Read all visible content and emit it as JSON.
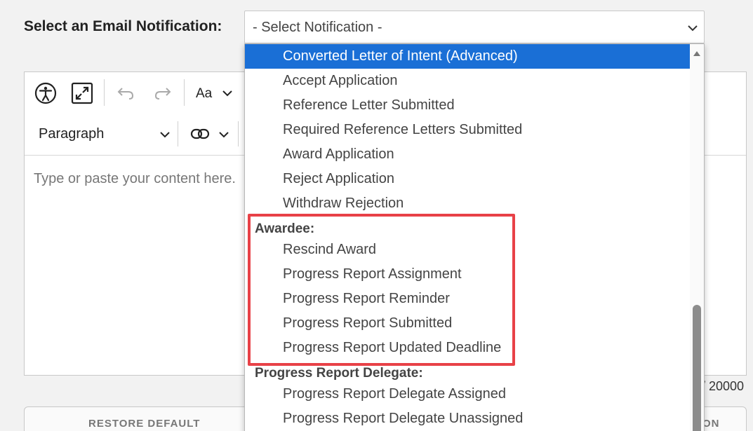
{
  "form": {
    "label": "Select an Email Notification:",
    "select_value": "- Select Notification -"
  },
  "editor": {
    "block_format": "Paragraph",
    "font_size_label": "Aa",
    "placeholder": "Type or paste your content here.",
    "counter": "/ 20000"
  },
  "buttons": {
    "restore": "RESTORE DEFAULT",
    "right_partial": "ON"
  },
  "dropdown": {
    "selected": "Converted Letter of Intent (Advanced)",
    "items_a": [
      "Accept Application",
      "Reference Letter Submitted",
      "Required Reference Letters Submitted",
      "Award Application",
      "Reject Application",
      "Withdraw Rejection"
    ],
    "group_awardee": "Awardee:",
    "items_awardee": [
      "Rescind Award",
      "Progress Report Assignment",
      "Progress Report Reminder",
      "Progress Report Submitted",
      "Progress Report Updated Deadline"
    ],
    "group_delegate": "Progress Report Delegate:",
    "items_delegate": [
      "Progress Report Delegate Assigned",
      "Progress Report Delegate Unassigned"
    ]
  },
  "icons": {
    "accessibility": "accessibility-icon",
    "fullscreen": "fullscreen-icon",
    "undo": "undo-icon",
    "redo": "redo-icon",
    "link": "link-icon",
    "chevron": "chevron-down-icon"
  }
}
